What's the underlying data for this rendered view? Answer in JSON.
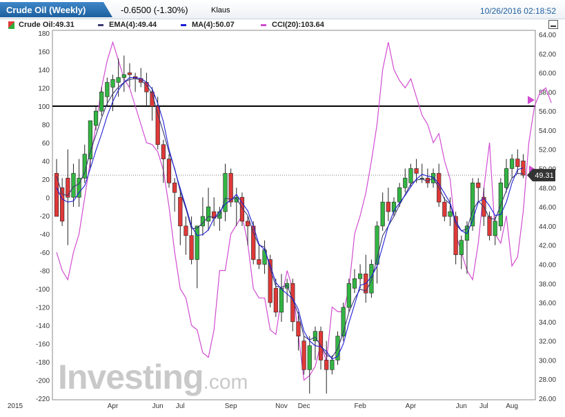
{
  "header": {
    "title": "Crude Oil (Weekly)",
    "change": "-0.6500 (-1.30%)",
    "user": "Klaus",
    "timestamp": "10/26/2016 02:18:52"
  },
  "legend": [
    {
      "label": "Crude Oil:49.31",
      "color": "#e23b3b"
    },
    {
      "label": "EMA(4):49.44",
      "color": "#3a3a70"
    },
    {
      "label": "MA(4):50.07",
      "color": "#1c1cd4"
    },
    {
      "label": "CCI(20):103.64",
      "color": "#d14bd1"
    }
  ],
  "watermark": {
    "brand": "Investing",
    "suffix": ".com"
  },
  "chart_data": {
    "type": "candlestick",
    "title": "Crude Oil (Weekly)",
    "x_labels": [
      {
        "label": "2015",
        "week": -3
      },
      {
        "label": "Apr",
        "week": 10
      },
      {
        "label": "Jun",
        "week": 18
      },
      {
        "label": "Jul",
        "week": 22
      },
      {
        "label": "Sep",
        "week": 31
      },
      {
        "label": "Nov",
        "week": 40
      },
      {
        "label": "Dec",
        "week": 44
      },
      {
        "label": "Feb",
        "week": 54
      },
      {
        "label": "Apr",
        "week": 63
      },
      {
        "label": "Jun",
        "week": 72
      },
      {
        "label": "Jul",
        "week": 76
      },
      {
        "label": "Aug",
        "week": 81
      }
    ],
    "price_axis": {
      "min": 26,
      "max": 64,
      "ticks": [
        "64.00",
        "62.00",
        "60.00",
        "58.00",
        "56.00",
        "54.00",
        "52.00",
        "50.00",
        "48.00",
        "46.00",
        "44.00",
        "42.00",
        "40.00",
        "38.00",
        "36.00",
        "34.00",
        "32.00",
        "30.00",
        "28.00",
        "26.00"
      ]
    },
    "cci_axis": {
      "min": -220,
      "max": 180,
      "ticks": [
        "180",
        "160",
        "140",
        "120",
        "100",
        "80",
        "60",
        "40",
        "20",
        "0",
        "-20",
        "-40",
        "-60",
        "-80",
        "-100",
        "-120",
        "-140",
        "-160",
        "-180",
        "-200",
        "-220"
      ]
    },
    "last_price": {
      "label": "49.31",
      "value": 49.31
    },
    "cci_reference_level": 100,
    "candles": [
      {
        "o": 49.5,
        "h": 51.0,
        "l": 45.0,
        "c": 45.0
      },
      {
        "o": 48.0,
        "h": 49.0,
        "l": 44.0,
        "c": 44.5
      },
      {
        "o": 49.0,
        "h": 52.0,
        "l": 42.0,
        "c": 47.0
      },
      {
        "o": 47.0,
        "h": 50.5,
        "l": 46.0,
        "c": 49.5
      },
      {
        "o": 47.0,
        "h": 51.0,
        "l": 46.0,
        "c": 49.0
      },
      {
        "o": 49.0,
        "h": 52.5,
        "l": 48.5,
        "c": 51.5
      },
      {
        "o": 51.0,
        "h": 55.0,
        "l": 50.0,
        "c": 55.0
      },
      {
        "o": 54.5,
        "h": 56.5,
        "l": 54.0,
        "c": 56.0
      },
      {
        "o": 56.0,
        "h": 58.5,
        "l": 55.5,
        "c": 58.0
      },
      {
        "o": 57.5,
        "h": 59.5,
        "l": 56.5,
        "c": 59.0
      },
      {
        "o": 58.5,
        "h": 59.8,
        "l": 56.0,
        "c": 59.3
      },
      {
        "o": 59.0,
        "h": 61.5,
        "l": 57.5,
        "c": 59.5
      },
      {
        "o": 59.5,
        "h": 61.8,
        "l": 58.0,
        "c": 59.8
      },
      {
        "o": 60.0,
        "h": 61.0,
        "l": 58.5,
        "c": 59.8
      },
      {
        "o": 59.6,
        "h": 60.0,
        "l": 58.0,
        "c": 59.4
      },
      {
        "o": 59.4,
        "h": 60.5,
        "l": 58.5,
        "c": 59.0
      },
      {
        "o": 59.0,
        "h": 60.0,
        "l": 56.5,
        "c": 58.0
      },
      {
        "o": 58.0,
        "h": 58.5,
        "l": 55.0,
        "c": 56.5
      },
      {
        "o": 56.5,
        "h": 57.5,
        "l": 52.0,
        "c": 52.5
      },
      {
        "o": 52.5,
        "h": 53.0,
        "l": 48.5,
        "c": 51.0
      },
      {
        "o": 51.0,
        "h": 51.5,
        "l": 48.0,
        "c": 48.5
      },
      {
        "o": 48.5,
        "h": 49.0,
        "l": 45.5,
        "c": 47.5
      },
      {
        "o": 47.0,
        "h": 48.0,
        "l": 42.0,
        "c": 44.0
      },
      {
        "o": 44.0,
        "h": 45.0,
        "l": 41.0,
        "c": 43.0
      },
      {
        "o": 43.0,
        "h": 45.0,
        "l": 40.0,
        "c": 40.5
      },
      {
        "o": 40.5,
        "h": 44.0,
        "l": 37.5,
        "c": 44.0
      },
      {
        "o": 44.0,
        "h": 47.0,
        "l": 43.0,
        "c": 45.0
      },
      {
        "o": 44.5,
        "h": 48.0,
        "l": 43.5,
        "c": 46.0
      },
      {
        "o": 45.5,
        "h": 47.0,
        "l": 44.0,
        "c": 44.8
      },
      {
        "o": 44.8,
        "h": 46.0,
        "l": 43.5,
        "c": 45.5
      },
      {
        "o": 45.5,
        "h": 50.5,
        "l": 44.5,
        "c": 49.5
      },
      {
        "o": 49.5,
        "h": 50.0,
        "l": 46.0,
        "c": 46.5
      },
      {
        "o": 46.5,
        "h": 48.0,
        "l": 44.0,
        "c": 47.0
      },
      {
        "o": 47.0,
        "h": 47.5,
        "l": 44.0,
        "c": 44.5
      },
      {
        "o": 44.5,
        "h": 45.0,
        "l": 42.0,
        "c": 44.0
      },
      {
        "o": 44.0,
        "h": 44.5,
        "l": 40.0,
        "c": 40.5
      },
      {
        "o": 40.5,
        "h": 42.0,
        "l": 39.5,
        "c": 40.0
      },
      {
        "o": 40.0,
        "h": 42.5,
        "l": 39.0,
        "c": 41.5
      },
      {
        "o": 40.5,
        "h": 41.0,
        "l": 35.5,
        "c": 36.0
      },
      {
        "o": 37.5,
        "h": 38.5,
        "l": 34.5,
        "c": 35.0
      },
      {
        "o": 35.0,
        "h": 39.0,
        "l": 34.0,
        "c": 37.5
      },
      {
        "o": 37.5,
        "h": 38.5,
        "l": 36.0,
        "c": 38.0
      },
      {
        "o": 38.0,
        "h": 38.5,
        "l": 33.0,
        "c": 34.0
      },
      {
        "o": 34.0,
        "h": 35.0,
        "l": 31.0,
        "c": 32.5
      },
      {
        "o": 32.0,
        "h": 32.5,
        "l": 28.5,
        "c": 29.0
      },
      {
        "o": 29.0,
        "h": 32.5,
        "l": 26.5,
        "c": 31.5
      },
      {
        "o": 32.0,
        "h": 33.5,
        "l": 30.0,
        "c": 33.0
      },
      {
        "o": 33.0,
        "h": 33.5,
        "l": 29.0,
        "c": 30.0
      },
      {
        "o": 30.0,
        "h": 32.0,
        "l": 26.5,
        "c": 29.0
      },
      {
        "o": 29.0,
        "h": 30.5,
        "l": 28.5,
        "c": 30.0
      },
      {
        "o": 30.0,
        "h": 33.0,
        "l": 29.5,
        "c": 32.5
      },
      {
        "o": 32.5,
        "h": 36.0,
        "l": 32.0,
        "c": 35.5
      },
      {
        "o": 35.5,
        "h": 38.5,
        "l": 35.0,
        "c": 38.0
      },
      {
        "o": 37.5,
        "h": 39.5,
        "l": 37.0,
        "c": 38.5
      },
      {
        "o": 38.5,
        "h": 40.0,
        "l": 37.5,
        "c": 39.0
      },
      {
        "o": 39.0,
        "h": 41.0,
        "l": 36.0,
        "c": 37.0
      },
      {
        "o": 37.0,
        "h": 40.5,
        "l": 36.5,
        "c": 40.0
      },
      {
        "o": 40.0,
        "h": 44.5,
        "l": 38.0,
        "c": 44.0
      },
      {
        "o": 44.0,
        "h": 47.5,
        "l": 43.5,
        "c": 46.5
      },
      {
        "o": 46.5,
        "h": 48.0,
        "l": 44.5,
        "c": 45.5
      },
      {
        "o": 45.5,
        "h": 47.0,
        "l": 45.0,
        "c": 46.5
      },
      {
        "o": 46.5,
        "h": 48.5,
        "l": 46.0,
        "c": 48.0
      },
      {
        "o": 48.0,
        "h": 50.0,
        "l": 47.5,
        "c": 49.0
      },
      {
        "o": 48.5,
        "h": 50.5,
        "l": 48.0,
        "c": 50.0
      },
      {
        "o": 50.0,
        "h": 51.0,
        "l": 48.5,
        "c": 49.5
      },
      {
        "o": 49.0,
        "h": 50.5,
        "l": 48.5,
        "c": 49.0
      },
      {
        "o": 49.0,
        "h": 50.0,
        "l": 48.0,
        "c": 48.5
      },
      {
        "o": 48.5,
        "h": 50.0,
        "l": 48.0,
        "c": 49.5
      },
      {
        "o": 49.5,
        "h": 50.5,
        "l": 46.0,
        "c": 46.5
      },
      {
        "o": 46.5,
        "h": 47.0,
        "l": 44.5,
        "c": 45.0
      },
      {
        "o": 45.0,
        "h": 47.0,
        "l": 44.0,
        "c": 45.5
      },
      {
        "o": 45.0,
        "h": 45.5,
        "l": 40.0,
        "c": 41.0
      },
      {
        "o": 41.0,
        "h": 43.0,
        "l": 39.5,
        "c": 42.5
      },
      {
        "o": 42.5,
        "h": 44.5,
        "l": 39.0,
        "c": 44.0
      },
      {
        "o": 44.0,
        "h": 49.0,
        "l": 43.5,
        "c": 48.5
      },
      {
        "o": 48.5,
        "h": 49.0,
        "l": 46.5,
        "c": 48.0
      },
      {
        "o": 47.0,
        "h": 48.0,
        "l": 44.0,
        "c": 45.0
      },
      {
        "o": 45.0,
        "h": 45.5,
        "l": 42.5,
        "c": 43.0
      },
      {
        "o": 43.0,
        "h": 45.0,
        "l": 42.0,
        "c": 44.5
      },
      {
        "o": 44.0,
        "h": 49.0,
        "l": 43.5,
        "c": 48.5
      },
      {
        "o": 48.0,
        "h": 51.0,
        "l": 47.5,
        "c": 50.0
      },
      {
        "o": 50.0,
        "h": 51.5,
        "l": 49.0,
        "c": 51.0
      },
      {
        "o": 51.0,
        "h": 52.0,
        "l": 49.5,
        "c": 50.2
      },
      {
        "o": 50.8,
        "h": 51.5,
        "l": 49.0,
        "c": 49.31
      }
    ],
    "ema4": [
      49.2,
      47.3,
      47.2,
      48.1,
      48.4,
      49.6,
      51.8,
      53.5,
      55.3,
      56.8,
      57.8,
      58.5,
      59.0,
      59.3,
      59.4,
      59.2,
      58.7,
      57.8,
      55.7,
      53.8,
      51.7,
      50.0,
      47.6,
      45.8,
      43.7,
      43.8,
      44.3,
      45.0,
      44.9,
      45.1,
      46.9,
      46.8,
      46.9,
      45.9,
      45.1,
      43.3,
      42.0,
      41.8,
      39.5,
      37.7,
      37.6,
      37.8,
      36.3,
      34.8,
      32.5,
      32.1,
      32.4,
      31.5,
      30.5,
      30.3,
      31.2,
      32.9,
      35.0,
      36.4,
      37.4,
      37.2,
      38.3,
      40.6,
      43.0,
      44.0,
      45.0,
      46.2,
      47.3,
      48.4,
      48.8,
      48.9,
      48.7,
      49.0,
      48.0,
      46.8,
      46.3,
      44.2,
      43.5,
      43.7,
      45.6,
      46.6,
      46.0,
      44.8,
      44.7,
      46.2,
      47.7,
      49.0,
      49.5,
      49.44
    ],
    "ma4": [
      48.0,
      46.8,
      46.5,
      46.6,
      47.5,
      48.2,
      50.0,
      51.9,
      53.6,
      55.5,
      57.0,
      58.2,
      59.0,
      59.5,
      59.5,
      59.4,
      59.0,
      58.3,
      56.8,
      54.9,
      52.0,
      49.9,
      47.9,
      46.0,
      44.0,
      43.0,
      43.1,
      43.6,
      44.8,
      45.5,
      46.3,
      46.7,
      47.3,
      46.4,
      45.6,
      44.0,
      42.1,
      41.5,
      39.9,
      38.1,
      37.4,
      36.9,
      36.4,
      35.3,
      33.0,
      32.0,
      31.5,
      31.4,
      30.9,
      30.1,
      30.4,
      31.7,
      33.9,
      35.8,
      37.8,
      38.0,
      38.7,
      39.8,
      41.9,
      44.0,
      45.6,
      46.4,
      47.2,
      48.1,
      48.9,
      49.4,
      49.2,
      49.1,
      48.4,
      47.4,
      46.4,
      44.5,
      43.5,
      43.2,
      44.6,
      46.5,
      46.9,
      46.1,
      45.1,
      45.2,
      46.5,
      48.5,
      49.9,
      50.07
    ],
    "cci20": [
      -60,
      -80,
      -90,
      -60,
      -40,
      0,
      40,
      80,
      120,
      150,
      170,
      150,
      130,
      120,
      100,
      80,
      60,
      58,
      50,
      30,
      -10,
      -60,
      -100,
      -110,
      -140,
      -145,
      -170,
      -175,
      -145,
      -80,
      -80,
      -40,
      -30,
      -20,
      -50,
      -100,
      -110,
      -110,
      -145,
      -150,
      -110,
      -80,
      -100,
      -150,
      -200,
      -195,
      -185,
      -160,
      -180,
      -120,
      -125,
      -125,
      -100,
      -40,
      -20,
      5,
      40,
      80,
      140,
      170,
      140,
      128,
      120,
      130,
      110,
      90,
      80,
      60,
      70,
      40,
      20,
      -40,
      -60,
      -80,
      -90,
      -50,
      10,
      60,
      -40,
      -50,
      -20,
      -75,
      -65,
      -15,
      60,
      100,
      115,
      120,
      103.64
    ]
  }
}
